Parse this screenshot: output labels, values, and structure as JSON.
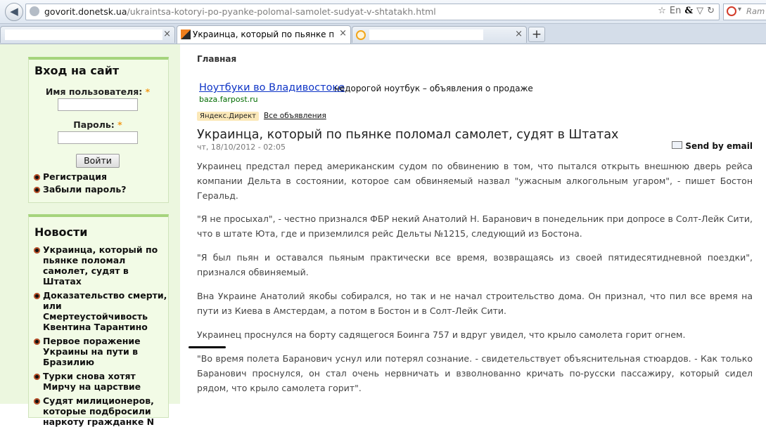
{
  "browser": {
    "url_host": "govorit.donetsk.ua",
    "url_path": "/ukraintsa-kotoryi-po-pyanke-polomal-samolet-sudyat-v-shtatakh.html",
    "lang_indicator": "En",
    "search_hint": "Ram",
    "tabs": [
      {
        "label": ""
      },
      {
        "label": "Украинца, который по пьянке поло..."
      },
      {
        "label": ""
      }
    ],
    "new_tab_label": "+"
  },
  "login_block": {
    "title": "Вход на сайт",
    "username_label": "Имя пользователя:",
    "password_label": "Пароль:",
    "required_mark": "*",
    "submit_label": "Войти",
    "links": [
      "Регистрация",
      "Забыли пароль?"
    ]
  },
  "news_block": {
    "title": "Новости",
    "items": [
      "Украинца, который по пьянке поломал самолет, судят в Штатах",
      "Доказательство смерти, или Смертеустойчивость Квентина Тарантино",
      "Первое поражение Украины на пути в Бразилию",
      "Турки снова хотят Мирчу на царствие",
      "Судят милиционеров, которые подбросили наркоту гражданке N"
    ]
  },
  "content": {
    "breadcrumb": "Главная",
    "ad": {
      "title": "Ноутбуки во Владивостоке",
      "description": "недорогой ноутбук – объявления о продаже",
      "url": "baza.farpost.ru",
      "direct_label": "Яндекс.Директ",
      "all_ads_label": "Все объявления"
    },
    "article_title": "Украинца, который по пьянке поломал самолет, судят в Штатах",
    "date": "чт, 18/10/2012 - 02:05",
    "send_email": "Send by email",
    "paragraphs": [
      "Украинец предстал перед американским судом по обвинению в том, что пытался открыть внешнюю дверь рейса компании Дельта в состоянии, которое сам обвиняемый назвал \"ужасным алкогольным угаром\", - пишет Бостон Геральд.",
      "\"Я не просыхал\", - честно признался ФБР некий Анатолий Н. Баранович в понедельник при допросе в Солт-Лейк Сити, что в штате Юта, где и приземлился рейс Дельты №1215, следующий из Бостона.",
      "\"Я был пьян и оставался пьяным практически все время, возвращаясь из своей пятидесятидневной поездки\", признался обвиняемый.",
      "Вна Украине Анатолий якобы собирался, но так и не начал строительство дома. Он признал, что пил все время на пути из Киева в Амстердам, а потом в Бостон и в Солт-Лейк Сити.",
      "Украинец проснулся на борту садящегося Боинга 757 и вдруг увидел, что крыло самолета горит огнем.",
      "\"Во время полета Баранович уснул или потерял сознание. - свидетельствует объяснительная стюардов. - Как только Баранович проснулся, он стал очень нервничать и взволнованно кричать по-русски пассажиру, который сидел рядом, что крыло самолета горит\"."
    ]
  }
}
